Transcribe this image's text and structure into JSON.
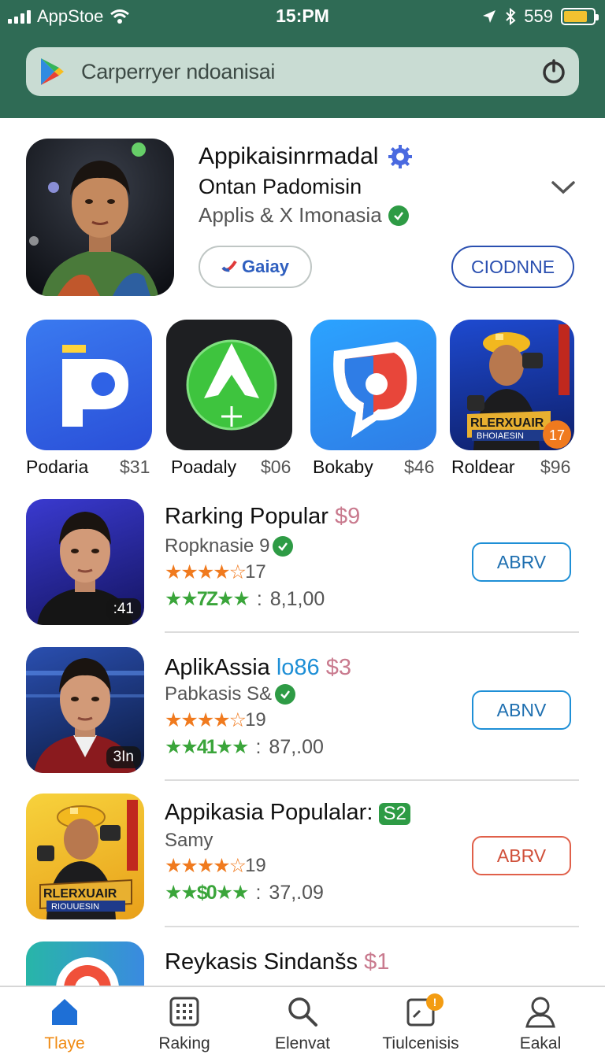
{
  "status_bar": {
    "carrier": "AppStoe",
    "time": "15:PM",
    "battery_percent": "559"
  },
  "search": {
    "text": "Carperryer ndoanisai"
  },
  "featured": {
    "title": "Appikaisinrmadal",
    "subtitle": "Ontan Padomisin",
    "developer": "Applis & X Imonasia",
    "get_label": "Gaiay",
    "open_label": "CIODNNE"
  },
  "tiles": [
    {
      "name": "Podaria",
      "price": "$31",
      "icon": "p-letter-icon"
    },
    {
      "name": "Poadaly",
      "price": "$06",
      "icon": "green-arrow-icon"
    },
    {
      "name": "Bokaby",
      "price": "$46",
      "icon": "chat-bubble-icon"
    },
    {
      "name": "Roldear",
      "price": "$96",
      "icon": "game-character-icon",
      "banner": "RLERXUAIR",
      "banner_sub": "BHOIAESIN",
      "badge": "17"
    }
  ],
  "list": [
    {
      "title": "Rarking Popular",
      "highlight": "",
      "price": "$9",
      "badge": "",
      "sub": "Ropknasie 9",
      "rating": "17",
      "green": "★★7Z★★",
      "value": "8,1,00",
      "action": "ABRV",
      "corner": ":41"
    },
    {
      "title": "AplikAssia",
      "highlight": "lo86",
      "price": "$3",
      "badge": "",
      "sub": "Pabkasis S&",
      "rating": "19",
      "green": "★★41★★",
      "value": "87,.00",
      "action": "ABNV",
      "corner": "3In"
    },
    {
      "title": "Appikasia Populalar:",
      "highlight": "",
      "price": "",
      "badge": "S2",
      "sub": "Samy",
      "rating": "19",
      "green": "★★$0★★",
      "value": "37,.09",
      "action": "ABRV",
      "corner": "",
      "banner": "RLERXUAIR",
      "banner_sub": "RIOUUESIN"
    },
    {
      "title": "Reykasis Sindanšs",
      "price": "$1"
    }
  ],
  "nav": [
    {
      "label": "Tlaye",
      "icon": "home-icon",
      "active": true
    },
    {
      "label": "Raking",
      "icon": "grid-icon"
    },
    {
      "label": "Elenvat",
      "icon": "search-icon"
    },
    {
      "label": "Tiulcenisis",
      "icon": "updates-icon",
      "badge": "!"
    },
    {
      "label": "Eakal",
      "icon": "profile-icon"
    }
  ],
  "colors": {
    "header": "#2f6b55",
    "accent_orange": "#f08a12",
    "button_blue": "#1e8fd6",
    "verified_green": "#2e9b45"
  }
}
